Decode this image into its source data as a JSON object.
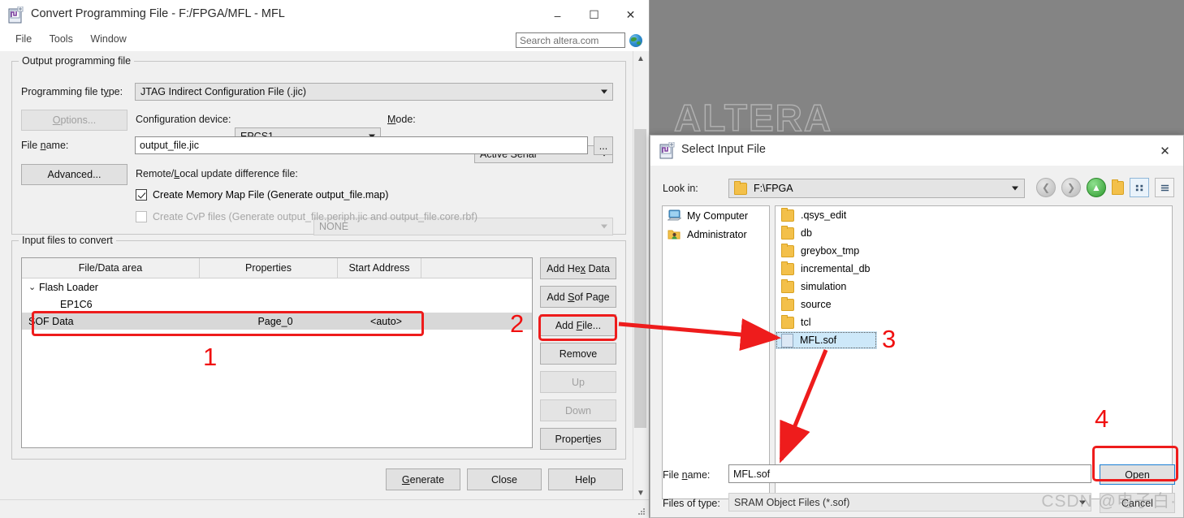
{
  "desktop": {
    "watermark": "ALTERA"
  },
  "main_window": {
    "title": "Convert Programming File - F:/FPGA/MFL - MFL",
    "icon": "quartus-convert-icon",
    "window_buttons": {
      "minimize": "–",
      "maximize": "☐",
      "close": "✕"
    },
    "menu": [
      "File",
      "Tools",
      "Window"
    ],
    "search": {
      "placeholder": "Search altera.com",
      "value": "",
      "icon": "globe-icon"
    },
    "output_group": {
      "legend": "Output programming file",
      "file_type_label": "Programming file type:",
      "file_type_value": "JTAG Indirect Configuration File (.jic)",
      "options_button": "Options...",
      "config_device_label": "Configuration device:",
      "config_device_value": "EPCS1",
      "mode_label": "Mode:",
      "mode_value": "Active Serial",
      "file_name_label": "File name:",
      "file_name_value": "output_file.jic",
      "browse_button": "...",
      "advanced_button": "Advanced...",
      "remote_label": "Remote/Local update difference file:",
      "remote_value": "NONE",
      "memmap_checkbox": "Create Memory Map File (Generate output_file.map)",
      "memmap_checked": true,
      "cvp_checkbox": "Create CvP files (Generate output_file.periph.jic and output_file.core.rbf)",
      "cvp_checked": false
    },
    "input_group": {
      "legend": "Input files to convert",
      "columns": [
        "File/Data area",
        "Properties",
        "Start Address"
      ],
      "rows": [
        {
          "name": "Flash Loader",
          "properties": "",
          "start_address": "",
          "indent": 0,
          "expander": "⌄",
          "selected": false
        },
        {
          "name": "EP1C6",
          "properties": "",
          "start_address": "",
          "indent": 1,
          "expander": "",
          "selected": false
        },
        {
          "name": "SOF Data",
          "properties": "Page_0",
          "start_address": "<auto>",
          "indent": 0,
          "expander": "",
          "selected": true
        }
      ],
      "side_buttons": [
        {
          "label": "Add Hex Data",
          "disabled": false
        },
        {
          "label": "Add Sof Page",
          "disabled": false
        },
        {
          "label": "Add File...",
          "disabled": false
        },
        {
          "label": "Remove",
          "disabled": false
        },
        {
          "label": "Up",
          "disabled": true
        },
        {
          "label": "Down",
          "disabled": true
        },
        {
          "label": "Properties",
          "disabled": false
        }
      ]
    },
    "footer_buttons": [
      "Generate",
      "Close",
      "Help"
    ]
  },
  "dialog": {
    "title": "Select Input File",
    "icon": "quartus-convert-icon",
    "close": "✕",
    "look_in_label": "Look in:",
    "look_in_value": "F:\\FPGA",
    "toolbar_icons": [
      "back-icon",
      "forward-icon",
      "up-one-level-icon",
      "new-folder-icon",
      "list-view-icon",
      "detail-view-icon"
    ],
    "places": [
      {
        "label": "My Computer",
        "icon": "computer-icon"
      },
      {
        "label": "Administrator",
        "icon": "user-folder-icon"
      }
    ],
    "files": [
      {
        "name": ".qsys_edit",
        "type": "folder",
        "selected": false
      },
      {
        "name": "db",
        "type": "folder",
        "selected": false
      },
      {
        "name": "greybox_tmp",
        "type": "folder",
        "selected": false
      },
      {
        "name": "incremental_db",
        "type": "folder",
        "selected": false
      },
      {
        "name": "simulation",
        "type": "folder",
        "selected": false
      },
      {
        "name": "source",
        "type": "folder",
        "selected": false
      },
      {
        "name": "tcl",
        "type": "folder",
        "selected": false
      },
      {
        "name": "MFL.sof",
        "type": "file",
        "selected": true
      }
    ],
    "file_name_label": "File name:",
    "file_name_value": "MFL.sof",
    "files_of_type_label": "Files of type:",
    "files_of_type_value": "SRAM Object Files (*.sof)",
    "open_button": "Open",
    "cancel_button": "Cancel"
  },
  "annotations": {
    "accent_color": "#ee1c1c",
    "steps": [
      "1",
      "2",
      "3",
      "4"
    ]
  },
  "watermarks": {
    "csdn": "CSDN @电子白·"
  }
}
